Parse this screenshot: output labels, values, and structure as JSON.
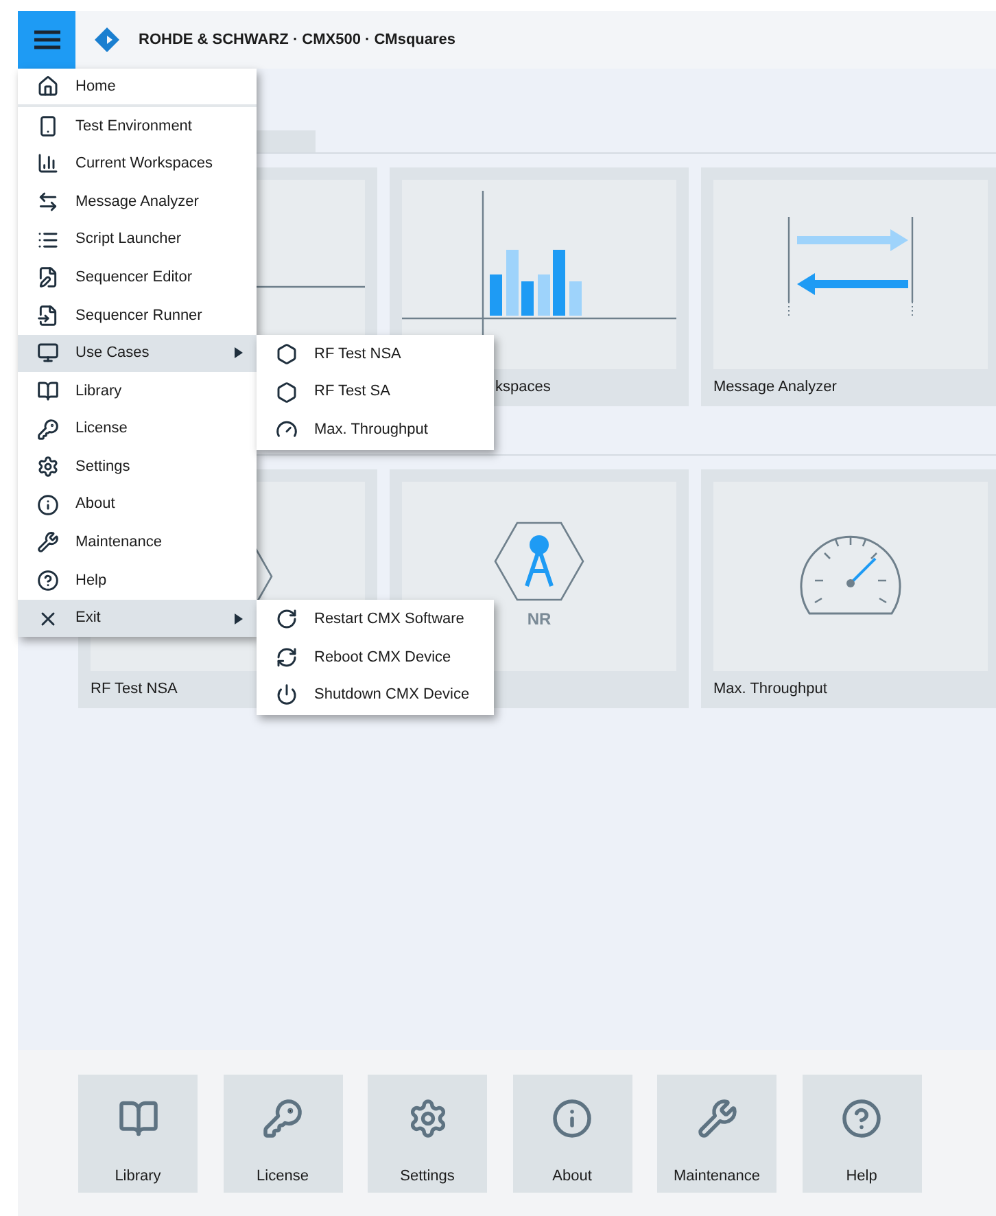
{
  "header": {
    "title": "ROHDE & SCHWARZ · CMX500 · CMsquares"
  },
  "menu": {
    "items": [
      {
        "label": "Home",
        "kind": "home",
        "expanded": false
      },
      {
        "label": "Test Environment",
        "kind": "plain",
        "expanded": false
      },
      {
        "label": "Current Workspaces",
        "kind": "plain",
        "expanded": false
      },
      {
        "label": "Message Analyzer",
        "kind": "plain",
        "expanded": false
      },
      {
        "label": "Script Launcher",
        "kind": "plain",
        "expanded": false
      },
      {
        "label": "Sequencer Editor",
        "kind": "plain",
        "expanded": false
      },
      {
        "label": "Sequencer Runner",
        "kind": "plain",
        "expanded": false
      },
      {
        "label": "Use Cases",
        "kind": "submenu",
        "expanded": true,
        "children": [
          {
            "label": "RF Test NSA"
          },
          {
            "label": "RF Test SA"
          },
          {
            "label": "Max. Throughput"
          }
        ]
      },
      {
        "label": "Library",
        "kind": "plain",
        "expanded": false
      },
      {
        "label": "License",
        "kind": "plain",
        "expanded": false
      },
      {
        "label": "Settings",
        "kind": "plain",
        "expanded": false
      },
      {
        "label": "About",
        "kind": "plain",
        "expanded": false
      },
      {
        "label": "Maintenance",
        "kind": "plain",
        "expanded": false
      },
      {
        "label": "Help",
        "kind": "plain",
        "expanded": false
      },
      {
        "label": "Exit",
        "kind": "submenu",
        "expanded": true,
        "children": [
          {
            "label": "Restart CMX Software"
          },
          {
            "label": "Reboot CMX Device"
          },
          {
            "label": "Shutdown CMX Device"
          }
        ]
      }
    ]
  },
  "tiles": [
    [
      {
        "kind": "line"
      },
      {
        "kind": "bars",
        "label": "kspaces"
      },
      {
        "kind": "arrows",
        "label": "Message Analyzer"
      }
    ],
    [
      {
        "kind": "hex",
        "label": "RF Test NSA"
      },
      {
        "kind": "hex",
        "caption": "NR"
      },
      {
        "kind": "gauge",
        "label": "Max. Throughput"
      }
    ]
  ],
  "quick_access": [
    {
      "label": "Library"
    },
    {
      "label": "License"
    },
    {
      "label": "Settings"
    },
    {
      "label": "About"
    },
    {
      "label": "Maintenance"
    },
    {
      "label": "Help"
    }
  ]
}
